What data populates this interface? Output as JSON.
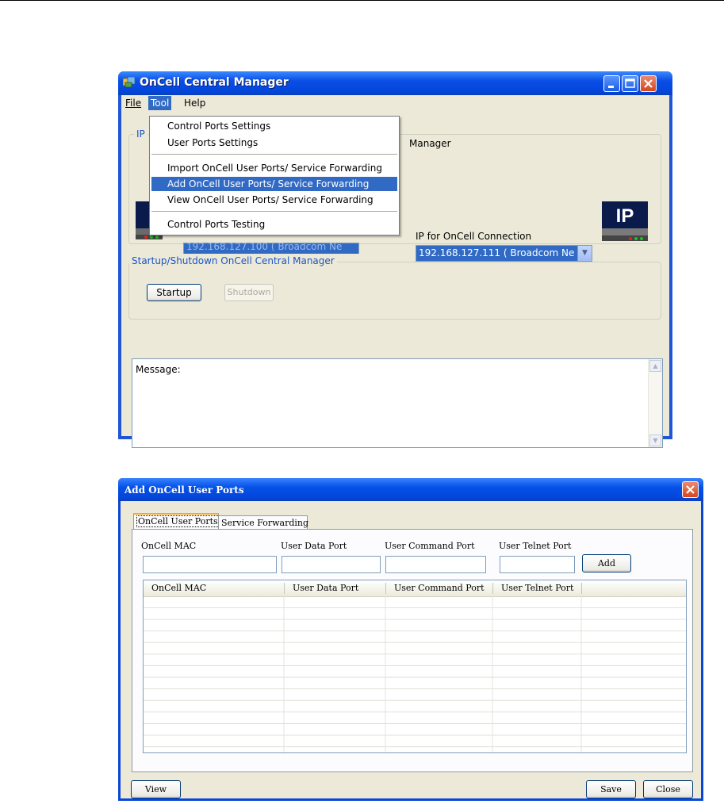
{
  "main_window": {
    "title": "OnCell Central Manager",
    "menu": [
      "File",
      "Tool",
      "Help"
    ],
    "group_ip_label_fragment": "IP",
    "group_ip_title_fragment": "Manager",
    "left_ip_combo_value": "192.168.127.100 ( Broadcom Ne",
    "ip_connection_label": "IP for OnCell Connection",
    "ip_connection_value": "192.168.127.111  ( Broadcom Ne",
    "ip_icon_text": "IP",
    "startup_group_title": "Startup/Shutdown OnCell Central Manager",
    "startup_button": "Startup",
    "shutdown_button": "Shutdown",
    "message_label": "Message:"
  },
  "tool_menu": {
    "items": [
      "Control Ports Settings",
      "User Ports Settings",
      "Import OnCell User Ports/ Service Forwarding",
      "Add OnCell User Ports/ Service Forwarding",
      "View OnCell User Ports/ Service Forwarding",
      "Control Ports Testing"
    ],
    "highlighted_item": "Add OnCell User Ports/ Service Forwarding"
  },
  "dialog": {
    "title": "Add OnCell User Ports",
    "tabs": [
      "OnCell User Ports",
      "Service Forwarding"
    ],
    "active_tab": "OnCell User Ports",
    "fields": {
      "mac_label": "OnCell MAC",
      "data_port_label": "User Data Port",
      "command_port_label": "User Command Port",
      "telnet_port_label": "User Telnet Port",
      "mac_value": "",
      "data_port_value": "",
      "command_port_value": "",
      "telnet_port_value": ""
    },
    "add_button": "Add",
    "table_columns": [
      "OnCell MAC",
      "User Data Port",
      "User Command Port",
      "User Telnet Port"
    ],
    "table_rows": [],
    "view_button": "View",
    "save_button": "Save",
    "close_button": "Close"
  },
  "colors": {
    "xp_title_blue": "#0a4ee4",
    "menu_highlight": "#316ac5",
    "window_face": "#ece9d8",
    "tab_accent": "#f3a830",
    "close_red": "#d6451d"
  }
}
